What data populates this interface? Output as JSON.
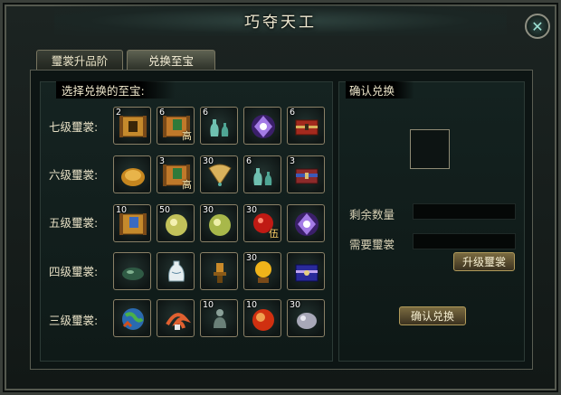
{
  "window": {
    "title": "巧夺天工"
  },
  "tabs": [
    {
      "label": "璽裳升品阶"
    },
    {
      "label": "兑换至宝"
    }
  ],
  "left_header": "选择兑换的至宝:",
  "right_header": "确认兑换",
  "rows": [
    {
      "label": "七级璽裳:",
      "items": [
        {
          "name": "scroll",
          "count": "2",
          "tag": ""
        },
        {
          "name": "green-scroll",
          "count": "6",
          "tag": "高"
        },
        {
          "name": "jade-bottles",
          "count": "6",
          "tag": ""
        },
        {
          "name": "purple-gem",
          "count": "",
          "tag": ""
        },
        {
          "name": "red-chest",
          "count": "6",
          "tag": ""
        }
      ]
    },
    {
      "label": "六级璽裳:",
      "items": [
        {
          "name": "gold-coin-pouch",
          "count": "",
          "tag": ""
        },
        {
          "name": "green-scroll",
          "count": "3",
          "tag": "高"
        },
        {
          "name": "gold-fan",
          "count": "30",
          "tag": ""
        },
        {
          "name": "jade-bottles",
          "count": "6",
          "tag": ""
        },
        {
          "name": "blue-chest",
          "count": "3",
          "tag": ""
        }
      ]
    },
    {
      "label": "五级璽裳:",
      "items": [
        {
          "name": "blue-scroll",
          "count": "10",
          "tag": ""
        },
        {
          "name": "green-orb",
          "count": "50",
          "tag": ""
        },
        {
          "name": "green-orb",
          "count": "30",
          "tag": ""
        },
        {
          "name": "red-orb",
          "count": "30",
          "tag": "伍"
        },
        {
          "name": "purple-gem",
          "count": "",
          "tag": ""
        }
      ]
    },
    {
      "label": "四级璽裳:",
      "items": [
        {
          "name": "jade-stone",
          "count": "",
          "tag": ""
        },
        {
          "name": "white-vase",
          "count": "",
          "tag": ""
        },
        {
          "name": "bronze-lamp",
          "count": "",
          "tag": ""
        },
        {
          "name": "gold-orb-stand",
          "count": "30",
          "tag": ""
        },
        {
          "name": "blue-treasure-chest",
          "count": "",
          "tag": ""
        }
      ]
    },
    {
      "label": "三级璽裳:",
      "items": [
        {
          "name": "earth-globe",
          "count": "",
          "tag": ""
        },
        {
          "name": "fire-swirl",
          "count": "",
          "tag": ""
        },
        {
          "name": "buddha-statue",
          "count": "10",
          "tag": ""
        },
        {
          "name": "fire-orb",
          "count": "10",
          "tag": ""
        },
        {
          "name": "silver-pouch",
          "count": "30",
          "tag": ""
        }
      ]
    }
  ],
  "fields": {
    "remaining_label": "剩余数量",
    "required_label": "需要璽裳"
  },
  "buttons": {
    "upgrade": "升级璽裳",
    "confirm": "确认兑换"
  },
  "colors": {
    "accent": "#b09a5a",
    "text": "#e6dfc4",
    "background": "#0d1514"
  }
}
